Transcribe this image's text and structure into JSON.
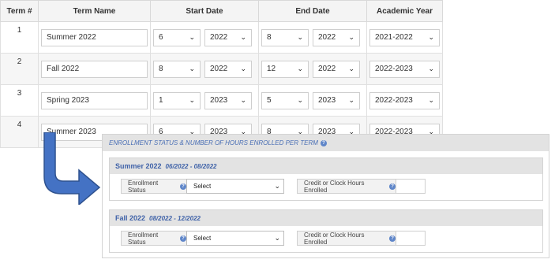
{
  "table": {
    "headers": [
      "Term #",
      "Term Name",
      "Start Date",
      "End Date",
      "Academic Year"
    ],
    "rows": [
      {
        "num": "1",
        "name": "Summer 2022",
        "start_month": "6",
        "start_year": "2022",
        "end_month": "8",
        "end_year": "2022",
        "academic_year": "2021-2022"
      },
      {
        "num": "2",
        "name": "Fall 2022",
        "start_month": "8",
        "start_year": "2022",
        "end_month": "12",
        "end_year": "2022",
        "academic_year": "2022-2023"
      },
      {
        "num": "3",
        "name": "Spring 2023",
        "start_month": "1",
        "start_year": "2023",
        "end_month": "5",
        "end_year": "2023",
        "academic_year": "2022-2023"
      },
      {
        "num": "4",
        "name": "Summer 2023",
        "start_month": "6",
        "start_year": "2023",
        "end_month": "8",
        "end_year": "2023",
        "academic_year": "2022-2023"
      }
    ]
  },
  "enrollment": {
    "title": "ENROLLMENT STATUS & NUMBER OF HOURS ENROLLED PER TERM",
    "terms": [
      {
        "name": "Summer 2022",
        "range": "06/2022 - 08/2022",
        "status_label": "Enrollment Status",
        "status_value": "Select",
        "hours_label": "Credit or Clock Hours Enrolled",
        "hours_value": ""
      },
      {
        "name": "Fall 2022",
        "range": "08/2022 - 12/2022",
        "status_label": "Enrollment Status",
        "status_value": "Select",
        "hours_label": "Credit or Clock Hours Enrolled",
        "hours_value": ""
      }
    ]
  },
  "icons": {
    "help": "help-circle-icon",
    "dropdown": "chevron-down-icon",
    "arrow": "curved-arrow-down-right-icon"
  },
  "colors": {
    "accent": "#3f62a8",
    "arrow": "#4472c4",
    "panel_header": "#e3e3e3"
  }
}
